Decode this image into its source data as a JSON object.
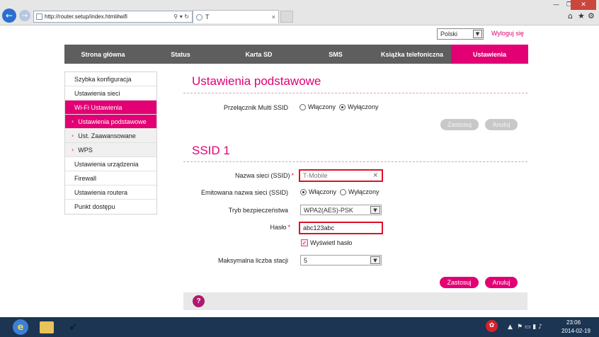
{
  "browser": {
    "url": "http://router.setup/index.html#wifi",
    "address_controls": "⚲ ▾ ↻",
    "tab_title": "T",
    "tab_close": "×",
    "window_controls": {
      "minimize": "—",
      "restore": "❐",
      "close": "✕"
    },
    "toolbar_icons": {
      "home": "⌂",
      "favorites": "★",
      "tools": "⚙"
    }
  },
  "header": {
    "language": "Polski",
    "logout": "Wyloguj się"
  },
  "main_nav": {
    "items": [
      {
        "label": "Strona główna"
      },
      {
        "label": "Status"
      },
      {
        "label": "Karta SD"
      },
      {
        "label": "SMS"
      },
      {
        "label": "Książka telefoniczna"
      },
      {
        "label": "Ustawienia"
      }
    ],
    "active": "Ustawienia"
  },
  "sidebar": {
    "quick_setup": "Szybka konfiguracja",
    "network_settings": "Ustawienia sieci",
    "wifi_settings": "Wi-Fi Ustawienia",
    "wifi_basic": "Ustawienia podstawowe",
    "wifi_advanced": "Ust. Zaawansowane",
    "wps": "WPS",
    "device_settings": "Ustawienia urządzenia",
    "firewall": "Firewall",
    "router_settings": "Ustawienia routera",
    "access_point": "Punkt dostępu"
  },
  "basic": {
    "title": "Ustawienia podstawowe",
    "multi_ssid_label": "Przełącznik Multi SSID",
    "on_label": "Włączony",
    "off_label": "Wyłączony",
    "multi_ssid_value": "off",
    "apply": "Zastosuj",
    "cancel": "Anuluj"
  },
  "ssid1": {
    "title": "SSID 1",
    "ssid_label": "Nazwa sieci (SSID)",
    "ssid_value": "T-Mobile",
    "required_mark": "*",
    "broadcast_label": "Emitowana nazwa sieci (SSID)",
    "broadcast_on": "Włączony",
    "broadcast_off": "Wyłączony",
    "broadcast_value": "on",
    "security_label": "Tryb bezpieczeństwa",
    "security_value": "WPA2(AES)-PSK",
    "password_label": "Hasło",
    "password_value": "abc123abc",
    "show_password": "Wyświetl hasło",
    "show_password_checked": true,
    "max_stations_label": "Maksymalna liczba stacji",
    "max_stations_value": "5",
    "apply": "Zastosuj",
    "cancel": "Anuluj"
  },
  "help": {
    "label": "?"
  },
  "taskbar": {
    "time": "23:06",
    "date": "2014-02-19",
    "ie_glyph": "e",
    "tray_up": "▲",
    "tray_icons": "⚑ ▭ ▮ ♪"
  },
  "colors": {
    "accent": "#e20074",
    "nav_bg": "#5e5e5e",
    "error_border": "#e0102a"
  }
}
